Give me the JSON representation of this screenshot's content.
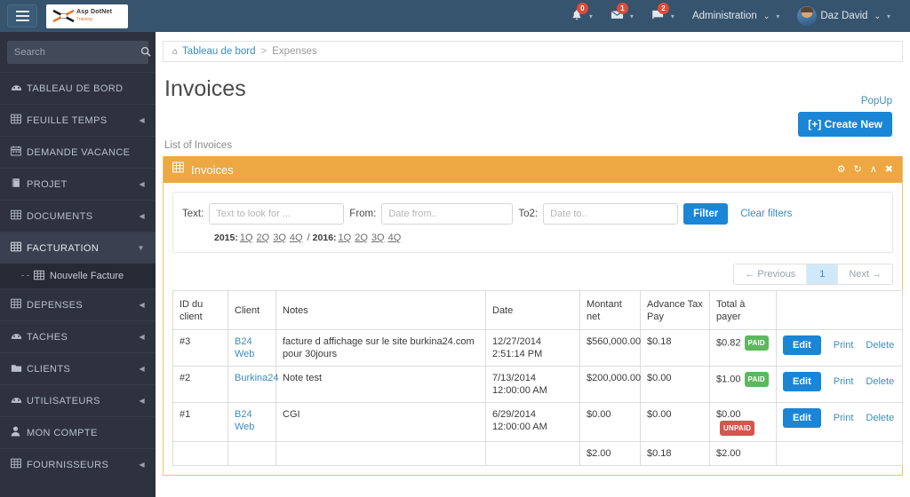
{
  "topbar": {
    "menu_icon": "hamburger-icon",
    "logo": {
      "name": "Asp DotNet",
      "tagline": "Training"
    },
    "notifications": {
      "icon": "bell-icon",
      "count": "0"
    },
    "messages": {
      "icon": "envelope-icon",
      "count": "1"
    },
    "tasks": {
      "icon": "flag-icon",
      "count": "2"
    },
    "admin_label": "Administration",
    "user_label": "Daz David"
  },
  "sidebar": {
    "search_placeholder": "Search",
    "search_value": "",
    "items": [
      {
        "label": "TABLEAU DE BORD",
        "icon": "dashboard-icon",
        "arrow": "",
        "active": false
      },
      {
        "label": "FEUILLE TEMPS",
        "icon": "grid-icon",
        "arrow": "◀",
        "active": false
      },
      {
        "label": "DEMANDE VACANCE",
        "icon": "calendar-icon",
        "arrow": "",
        "active": false
      },
      {
        "label": "PROJET",
        "icon": "book-icon",
        "arrow": "◀",
        "active": false
      },
      {
        "label": "DOCUMENTS",
        "icon": "grid-icon",
        "arrow": "◀",
        "active": false
      },
      {
        "label": "FACTURATION",
        "icon": "grid-icon",
        "arrow": "▼",
        "active": true
      },
      {
        "label": "DEPENSES",
        "icon": "grid-icon",
        "arrow": "◀",
        "active": false
      },
      {
        "label": "TACHES",
        "icon": "dashboard-icon",
        "arrow": "◀",
        "active": false
      },
      {
        "label": "CLIENTS",
        "icon": "folder-icon",
        "arrow": "◀",
        "active": false
      },
      {
        "label": "UTILISATEURS",
        "icon": "dashboard-icon",
        "arrow": "◀",
        "active": false
      },
      {
        "label": "MON COMPTE",
        "icon": "user-icon",
        "arrow": "",
        "active": false
      },
      {
        "label": "FOURNISSEURS",
        "icon": "grid-icon",
        "arrow": "◀",
        "active": false
      }
    ],
    "submenu": {
      "parent_index": 5,
      "label": "Nouvelle Facture",
      "icon": "grid-icon"
    }
  },
  "breadcrumb": {
    "home_icon": "home-icon",
    "root": "Tableau de bord",
    "separator": ">",
    "current": "Expenses"
  },
  "page": {
    "title": "Invoices",
    "popup_link": "PopUp",
    "create_button": "[+] Create New",
    "subtitle": "List of Invoices"
  },
  "panel": {
    "icon": "grid-icon",
    "title": "Invoices",
    "tools": [
      {
        "name": "gear-icon",
        "glyph": "⚙"
      },
      {
        "name": "refresh-icon",
        "glyph": "↻"
      },
      {
        "name": "collapse-icon",
        "glyph": "∧"
      },
      {
        "name": "close-icon",
        "glyph": "✖"
      }
    ],
    "accent_color": "#eda843"
  },
  "filters": {
    "text_label": "Text:",
    "text_placeholder": "Text to look for ...",
    "text_value": "",
    "from_label": "From:",
    "from_placeholder": "Date from..",
    "from_value": "",
    "to_label": "To2:",
    "to_placeholder": "Date to..",
    "to_value": "",
    "filter_button": "Filter",
    "clear_link": "Clear filters",
    "quarters": {
      "year1": "2015:",
      "year1_links": [
        "1Q",
        "2Q",
        "3Q",
        "4Q"
      ],
      "divider": "/",
      "year2": "2016:",
      "year2_links": [
        "1Q",
        "2Q",
        "3Q",
        "4Q"
      ]
    }
  },
  "pagination": {
    "previous": "← Previous",
    "current": "1",
    "next": "Next →"
  },
  "table": {
    "columns": [
      "ID du client",
      "Client",
      "Notes",
      "Date",
      "Montant net",
      "Advance Tax Pay",
      "Total à payer",
      ""
    ],
    "rows": [
      {
        "id": "#3",
        "client": "B24 Web",
        "notes": "facture d affichage sur le site burkina24.com pour 30jours",
        "date": "12/27/2014 2:51:14 PM",
        "net": "$560,000.00",
        "advance": "$0.18",
        "total": "$0.82",
        "status": "PAID",
        "status_type": "paid"
      },
      {
        "id": "#2",
        "client": "Burkina24",
        "notes": "Note test",
        "date": "7/13/2014 12:00:00 AM",
        "net": "$200,000.00",
        "advance": "$0.00",
        "total": "$1.00",
        "status": "PAID",
        "status_type": "paid"
      },
      {
        "id": "#1",
        "client": "B24 Web",
        "notes": "CGI",
        "date": "6/29/2014 12:00:00 AM",
        "net": "$0.00",
        "advance": "$0.00",
        "total": "$0.00",
        "status": "UNPAID",
        "status_type": "unpaid"
      }
    ],
    "totals": {
      "net": "$2.00",
      "advance": "$0.18",
      "total": "$2.00"
    },
    "actions": {
      "edit": "Edit",
      "print": "Print",
      "delete": "Delete"
    }
  }
}
